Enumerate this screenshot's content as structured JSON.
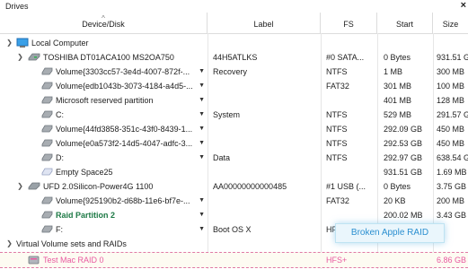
{
  "window": {
    "title": "Drives"
  },
  "columns": {
    "device": "Device/Disk",
    "label": "Label",
    "fs": "FS",
    "start": "Start",
    "size": "Size"
  },
  "rows": [
    {
      "name": "Local Computer",
      "label": "",
      "fs": "",
      "start": "",
      "size": ""
    },
    {
      "name": "TOSHIBA DT01ACA100 MS2OA750",
      "label": "44H5ATLKS",
      "fs": "#0 SATA...",
      "start": "0 Bytes",
      "size": "931.51 GB"
    },
    {
      "name": "Volume{3303cc57-3e4d-4007-872f-...",
      "label": "Recovery",
      "fs": "NTFS",
      "start": "1 MB",
      "size": "300 MB"
    },
    {
      "name": "Volume{edb1043b-3073-4184-a4d5-...",
      "label": "",
      "fs": "FAT32",
      "start": "301 MB",
      "size": "100 MB"
    },
    {
      "name": "Microsoft reserved partition",
      "label": "",
      "fs": "",
      "start": "401 MB",
      "size": "128 MB"
    },
    {
      "name": "C:",
      "label": "System",
      "fs": "NTFS",
      "start": "529 MB",
      "size": "291.57 GB"
    },
    {
      "name": "Volume{44fd3858-351c-43f0-8439-1...",
      "label": "",
      "fs": "NTFS",
      "start": "292.09 GB",
      "size": "450 MB"
    },
    {
      "name": "Volume{e0a573f2-14d5-4047-adfc-3...",
      "label": "",
      "fs": "NTFS",
      "start": "292.53 GB",
      "size": "450 MB"
    },
    {
      "name": "D:",
      "label": "Data",
      "fs": "NTFS",
      "start": "292.97 GB",
      "size": "638.54 GB"
    },
    {
      "name": "Empty Space25",
      "label": "",
      "fs": "",
      "start": "931.51 GB",
      "size": "1.69 MB"
    },
    {
      "name": "UFD 2.0Silicon-Power4G 1100",
      "label": "AA00000000000485",
      "fs": "#1 USB (...",
      "start": "0 Bytes",
      "size": "3.75 GB"
    },
    {
      "name": "Volume{925190b2-d68b-11e6-bf7e-...",
      "label": "",
      "fs": "FAT32",
      "start": "20 KB",
      "size": "200 MB"
    },
    {
      "name": "Raid Partition 2",
      "label": "",
      "fs": "",
      "start": "200.02 MB",
      "size": "3.43 GB"
    },
    {
      "name": "F:",
      "label": "Boot OS X",
      "fs": "HFS+",
      "start": "",
      "size": ""
    },
    {
      "name": "Virtual Volume sets and RAIDs",
      "label": "",
      "fs": "",
      "start": "",
      "size": ""
    },
    {
      "name": "Test Mac RAID 0",
      "label": "",
      "fs": "HFS+",
      "start": "",
      "size": "6.86 GB"
    }
  ],
  "tooltip": {
    "text": "Broken Apple RAID"
  },
  "icons": {
    "expanded": "chevron-down-icon",
    "computer": "computer-icon",
    "disk": "hard-disk-icon",
    "volume": "volume-icon",
    "raid": "raid-icon"
  },
  "colors": {
    "raid_partition": "#1e7a46",
    "virtual_raid": "#e85aa0",
    "tooltip_text": "#2b8fd0",
    "selection_border": "#e07aa6"
  }
}
